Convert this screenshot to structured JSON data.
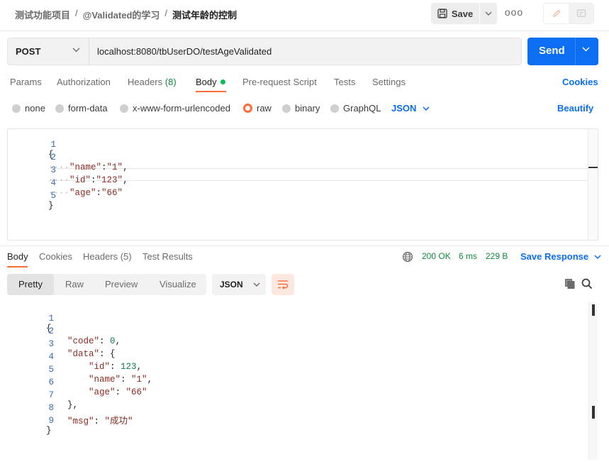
{
  "breadcrumb": {
    "items": [
      "测试功能项目",
      "@Validated的学习"
    ],
    "separator": "/",
    "current": "测试年龄的控制"
  },
  "header": {
    "save_label": "Save",
    "more_label": "ooo"
  },
  "request": {
    "method": "POST",
    "url": "localhost:8080/tbUserDO/testAgeValidated",
    "send_label": "Send"
  },
  "request_tabs": {
    "params": "Params",
    "authorization": "Authorization",
    "headers": "Headers",
    "headers_count": "(8)",
    "body": "Body",
    "pre_request": "Pre-request Script",
    "tests": "Tests",
    "settings": "Settings",
    "cookies": "Cookies"
  },
  "body_types": {
    "none": "none",
    "form_data": "form-data",
    "urlencoded": "x-www-form-urlencoded",
    "raw": "raw",
    "binary": "binary",
    "graphql": "GraphQL",
    "selected": "raw",
    "language": "JSON",
    "beautify": "Beautify"
  },
  "request_body": {
    "line_numbers": [
      "1",
      "2",
      "3",
      "4",
      "5"
    ],
    "brace_open": "{",
    "brace_close": "}",
    "lines": [
      {
        "key": "\"name\"",
        "value": "\"1\"",
        "comma": ","
      },
      {
        "key": "\"id\"",
        "value": "\"123\"",
        "comma": ","
      },
      {
        "key": "\"age\"",
        "value": "\"66\"",
        "comma": ""
      }
    ]
  },
  "response_tabs": {
    "body": "Body",
    "cookies": "Cookies",
    "headers": "Headers",
    "headers_count": "(5)",
    "test_results": "Test Results"
  },
  "response_status": {
    "code": "200 OK",
    "time": "6 ms",
    "size": "229 B",
    "save_response": "Save Response"
  },
  "response_view": {
    "pretty": "Pretty",
    "raw": "Raw",
    "preview": "Preview",
    "visualize": "Visualize",
    "format": "JSON"
  },
  "response_body": {
    "line_numbers": [
      "1",
      "2",
      "3",
      "4",
      "5",
      "6",
      "7",
      "8",
      "9"
    ],
    "l1": "{",
    "l2_key": "\"code\"",
    "l2_val": "0",
    "l3_key": "\"data\"",
    "l3_open": "{",
    "l4_key": "\"id\"",
    "l4_val": "123",
    "l5_key": "\"name\"",
    "l5_val": "\"1\"",
    "l6_key": "\"age\"",
    "l6_val": "\"66\"",
    "l7": "},",
    "l8_key": "\"msg\"",
    "l8_val": "\"成功\"",
    "l9": "}"
  },
  "colors": {
    "accent": "#ff6c37",
    "primary": "#0b6ef3",
    "success": "#0f8a3c"
  }
}
